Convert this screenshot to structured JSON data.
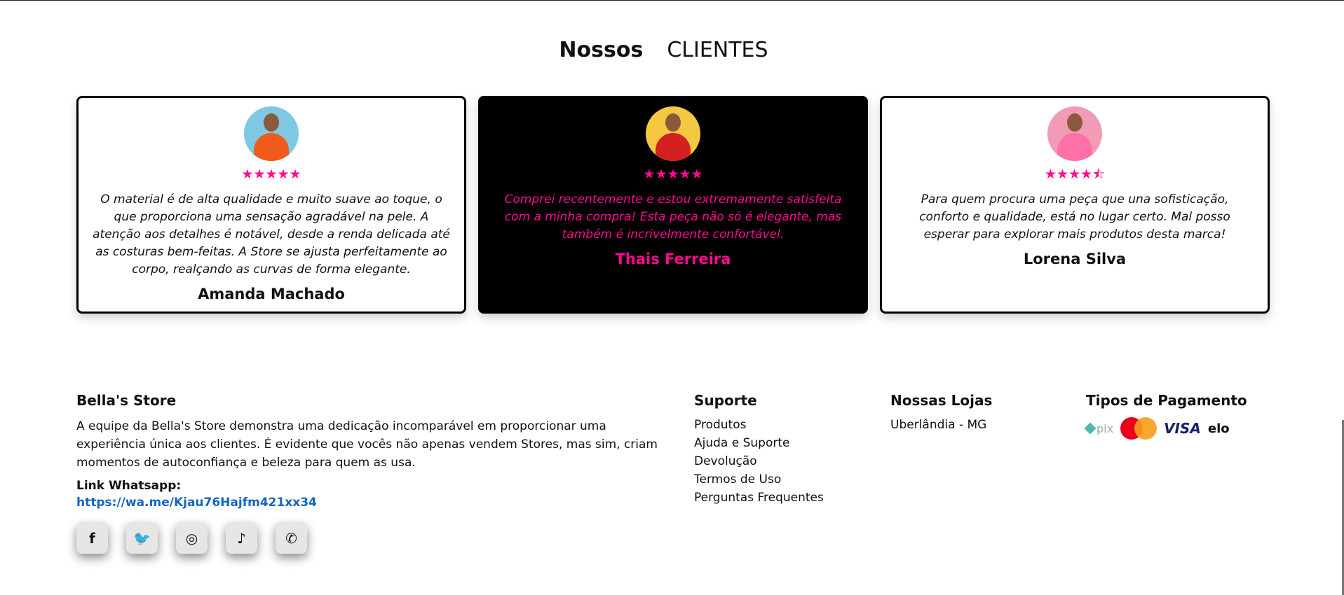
{
  "section": {
    "title_a": "Nossos",
    "title_b": "CLIENTES"
  },
  "testimonials": [
    {
      "quote": "O material é de alta qualidade e muito suave ao toque, o que proporciona uma sensação agradável na pele. A atenção aos detalhes é notável, desde a renda delicada até as costuras bem-feitas. A Store se ajusta perfeitamente ao corpo, realçando as curvas de forma elegante.",
      "name": "Amanda Machado",
      "stars": "★★★★★",
      "rating": 5,
      "avatar_bg": "#7ec8e3",
      "avatar_shirt": "#f05a1a"
    },
    {
      "quote": "Comprei recentemente e estou extremamente satisfeita com a minha compra! Esta peça não só é elegante, mas também é incrivelmente confortável.",
      "name": "Thais Ferreira",
      "stars": "★★★★★",
      "rating": 5,
      "avatar_bg": "#f5c842",
      "avatar_shirt": "#d32020"
    },
    {
      "quote": "Para quem procura uma peça que una sofisticação, conforto e qualidade, está no lugar certo. Mal posso esperar para explorar mais produtos desta marca!",
      "name": "Lorena Silva",
      "stars": "★★★★⯪",
      "rating": 4.5,
      "avatar_bg": "#f29bb5",
      "avatar_shirt": "#ff6fa8"
    }
  ],
  "footer": {
    "brand_title": "Bella's Store",
    "brand_text": "A equipe da Bella's Store demonstra uma dedicação incomparável em proporcionar uma experiência única aos clientes. É evidente que vocês não apenas vendem Stores, mas sim, criam momentos de autoconfiança e beleza para quem as usa.",
    "whatsapp_label": "Link Whatsapp:",
    "whatsapp_link": "https://wa.me/Kjau76Hajfm421xx34",
    "socials": [
      {
        "name": "facebook-icon",
        "glyph": "f"
      },
      {
        "name": "twitter-icon",
        "glyph": "🐦"
      },
      {
        "name": "instagram-icon",
        "glyph": "◎"
      },
      {
        "name": "tiktok-icon",
        "glyph": "♪"
      },
      {
        "name": "whatsapp-icon",
        "glyph": "✆"
      }
    ],
    "support_title": "Suporte",
    "support_links": [
      "Produtos",
      "Ajuda e Suporte",
      "Devolução",
      "Termos de Uso",
      "Perguntas Frequentes"
    ],
    "stores_title": "Nossas Lojas",
    "stores": [
      "Uberlândia - MG"
    ],
    "payment_title": "Tipos de Pagamento",
    "payment_logos": {
      "pix": "pix",
      "visa": "VISA",
      "elo": "elo"
    }
  },
  "colors": {
    "accent": "#ff0a8f",
    "link": "#1565c0",
    "dark_card": "#000000"
  }
}
